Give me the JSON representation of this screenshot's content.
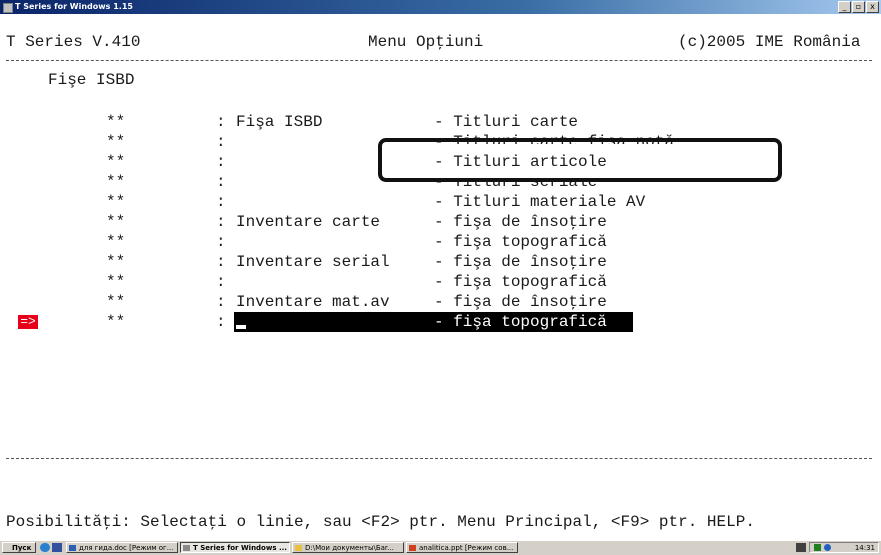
{
  "window": {
    "title": "T Series for Windows 1.15",
    "buttons": {
      "minimize": "_",
      "maximize": "▫",
      "close": "x"
    }
  },
  "header": {
    "app": "T Series V.410",
    "menu_title": "Menu Opţiuni",
    "copyright": "(c)2005 IME România"
  },
  "section_title": "Fişe ISBD",
  "menu_rows": [
    {
      "marker": "**",
      "sep": ":",
      "group": "Fişa ISBD",
      "option": "- Titluri carte"
    },
    {
      "marker": "**",
      "sep": ":",
      "group": "",
      "option": "- Titluri carte fişa notă"
    },
    {
      "marker": "**",
      "sep": ":",
      "group": "",
      "option": "- Titluri articole"
    },
    {
      "marker": "**",
      "sep": ":",
      "group": "",
      "option": "- Titluri seriale"
    },
    {
      "marker": "**",
      "sep": ":",
      "group": "",
      "option": "- Titluri materiale AV"
    },
    {
      "marker": "**",
      "sep": ":",
      "group": "Inventare carte",
      "option": "- fişa de însoţire"
    },
    {
      "marker": "**",
      "sep": ":",
      "group": "",
      "option": "- fişa topografică"
    },
    {
      "marker": "**",
      "sep": ":",
      "group": "Inventare serial",
      "option": "- fişa de însoţire"
    },
    {
      "marker": "**",
      "sep": ":",
      "group": "",
      "option": "- fişa topografică"
    },
    {
      "marker": "**",
      "sep": ":",
      "group": "Inventare mat.av",
      "option": "- fişa de însoţire"
    },
    {
      "marker": "**",
      "sep": ":",
      "group": "",
      "option": "- fişa topografică"
    }
  ],
  "selection_arrow": "=>",
  "footer_hint": "Posibilităţi: Selectaţi o linie, sau <F2> ptr. Menu Principal, <F9> ptr. HELP.",
  "taskbar": {
    "start_label": "Пуск",
    "tasks": [
      "для гида.doc [Режим ог...",
      "T Series for Windows ...",
      "D:\\Мои документы\\Бar...",
      "analitica.ppt [Режим сов..."
    ],
    "tray_icons": [
      "keyboard-layout-icon",
      "network-icon",
      "volume-icon"
    ],
    "clock": "14:31"
  },
  "colors": {
    "titlebar_start": "#0a246a",
    "selection_bg": "#000000",
    "arrow_bg": "#e8001a"
  }
}
